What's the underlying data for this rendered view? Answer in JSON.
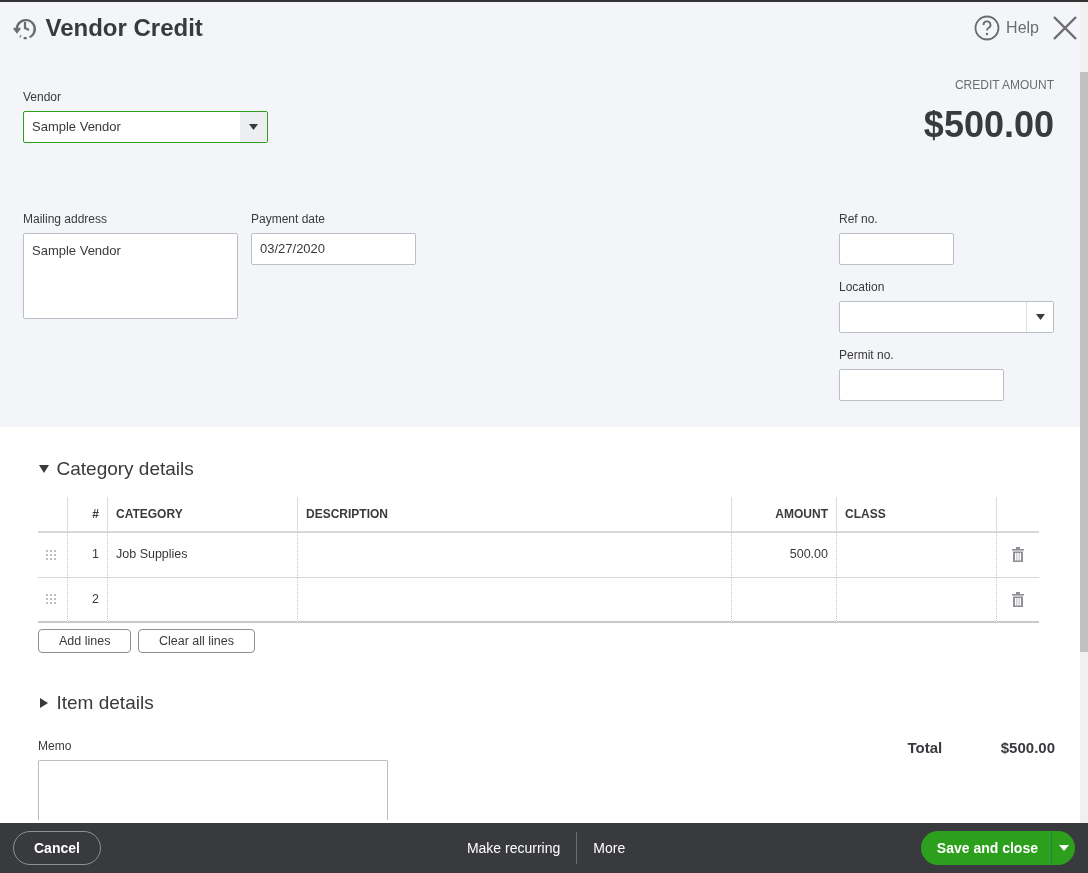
{
  "window": {
    "title": "Vendor Credit"
  },
  "header": {
    "help": "Help"
  },
  "credit_amount": {
    "label": "CREDIT AMOUNT",
    "value": "$500.00"
  },
  "vendor": {
    "label": "Vendor",
    "value": "Sample Vendor",
    "focused": true
  },
  "mailing_address": {
    "label": "Mailing address",
    "value": "Sample Vendor"
  },
  "payment_date": {
    "label": "Payment date",
    "value": "03/27/2020"
  },
  "ref_no": {
    "label": "Ref no."
  },
  "location": {
    "label": "Location"
  },
  "permit_no": {
    "label": "Permit no."
  },
  "category_details": {
    "title": "Category details",
    "expanded": true,
    "columns": [
      "#",
      "CATEGORY",
      "DESCRIPTION",
      "AMOUNT",
      "CLASS"
    ],
    "rows": [
      {
        "number": "1",
        "category": "Job Supplies",
        "amount": "500.00"
      },
      {
        "number": "2"
      }
    ],
    "buttons": [
      "Add lines",
      "Clear all lines"
    ]
  },
  "item_details": {
    "title": "Item details",
    "expanded": false
  },
  "memo": {
    "label": "Memo"
  },
  "total": {
    "label": "Total",
    "value": "$500.00"
  },
  "footer": {
    "cancel": "Cancel",
    "actions": [
      "Make recurring",
      "More"
    ],
    "primary": "Save and close"
  }
}
